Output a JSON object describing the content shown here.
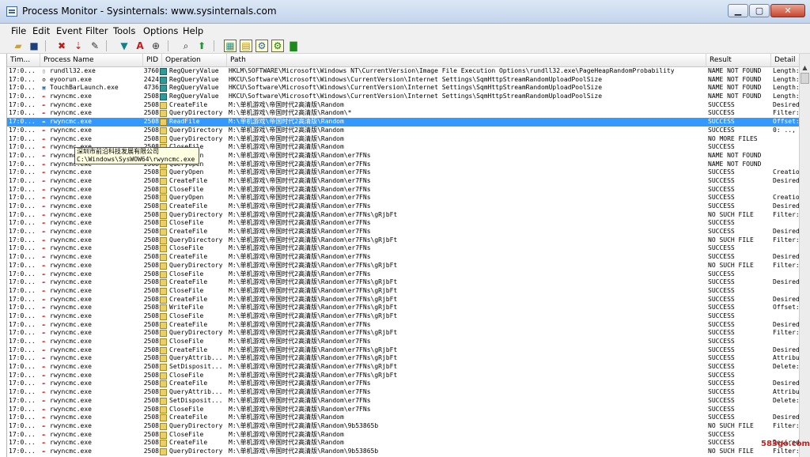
{
  "window": {
    "title": "Process Monitor - Sysinternals: www.sysinternals.com",
    "min": "▁",
    "max": "▢",
    "close": "✕"
  },
  "menu": [
    "File",
    "Edit",
    "Event",
    "Filter",
    "Tools",
    "Options",
    "Help"
  ],
  "columns": [
    "Tim...",
    "Process Name",
    "PID",
    "Operation",
    "Path",
    "Result",
    "Detail"
  ],
  "rows": [
    {
      "t": "17:0...",
      "p": "rundll32.exe",
      "pid": "3760",
      "op": "RegQueryValue",
      "path": "HKLM\\SOFTWARE\\Microsoft\\Windows NT\\CurrentVersion\\Image File Execution Options\\rundll32.exe\\PageHeapRandomProbability",
      "res": "NAME NOT FOUND",
      "det": "Length:",
      "pi": "doc",
      "oi": "reg"
    },
    {
      "t": "17:0...",
      "p": "eyoorun.exe",
      "pid": "2424",
      "op": "RegQueryValue",
      "path": "HKCU\\Software\\Microsoft\\Windows\\CurrentVersion\\Internet Settings\\SqmHttpStreamRandomUploadPoolSize",
      "res": "NAME NOT FOUND",
      "det": "Length:",
      "pi": "gear",
      "oi": "reg"
    },
    {
      "t": "17:0...",
      "p": "TouchBarLaunch.exe",
      "pid": "4736",
      "op": "RegQueryValue",
      "path": "HKCU\\Software\\Microsoft\\Windows\\CurrentVersion\\Internet Settings\\SqmHttpStreamRandomUploadPoolSize",
      "res": "NAME NOT FOUND",
      "det": "Length:",
      "pi": "app",
      "oi": "reg"
    },
    {
      "t": "17:0...",
      "p": "rwyncmc.exe",
      "pid": "2508",
      "op": "RegQueryValue",
      "path": "HKCU\\Software\\Microsoft\\Windows\\CurrentVersion\\Internet Settings\\SqmHttpStreamRandomUploadPoolSize",
      "res": "NAME NOT FOUND",
      "det": "Length:",
      "pi": "feather",
      "oi": "reg"
    },
    {
      "t": "17:0...",
      "p": "rwyncmc.exe",
      "pid": "2508",
      "op": "CreateFile",
      "path": "M:\\单机游戏\\帝国时代2高清版\\Random",
      "res": "SUCCESS",
      "det": "Desired",
      "pi": "feather",
      "oi": "file"
    },
    {
      "t": "17:0...",
      "p": "rwyncmc.exe",
      "pid": "2508",
      "op": "QueryDirectory",
      "path": "M:\\单机游戏\\帝国时代2高清版\\Random\\*",
      "res": "SUCCESS",
      "det": "Filter:",
      "pi": "feather",
      "oi": "file"
    },
    {
      "t": "17:0...",
      "p": "rwyncmc.exe",
      "pid": "2508",
      "op": "ReadFile",
      "path": "M:\\单机游戏\\帝国时代2高清版\\Random",
      "res": "SUCCESS",
      "det": "Offset:",
      "pi": "feather",
      "oi": "file",
      "sel": true
    },
    {
      "t": "17:0...",
      "p": "rwyncmc.exe",
      "pid": "2508",
      "op": "QueryDirectory",
      "path": "M:\\单机游戏\\帝国时代2高清版\\Random",
      "res": "SUCCESS",
      "det": "0: ..,",
      "pi": "feather",
      "oi": "file"
    },
    {
      "t": "17:0...",
      "p": "rwyncmc.exe",
      "pid": "2508",
      "op": "QueryDirectory",
      "path": "M:\\单机游戏\\帝国时代2高清版\\Random",
      "res": "NO MORE FILES",
      "det": "",
      "pi": "feather",
      "oi": "file"
    },
    {
      "t": "17:0...",
      "p": "rwyncmc.exe",
      "pid": "2508",
      "op": "CloseFile",
      "path": "M:\\单机游戏\\帝国时代2高清版\\Random",
      "res": "SUCCESS",
      "det": "",
      "pi": "feather",
      "oi": "file"
    },
    {
      "t": "17:0...",
      "p": "rwyncmc.exe",
      "pid": "2508",
      "op": "QueryOpen",
      "path": "M:\\单机游戏\\帝国时代2高清版\\Random\\er7FNs",
      "res": "NAME NOT FOUND",
      "det": "",
      "pi": "feather",
      "oi": "file"
    },
    {
      "t": "17:0...",
      "p": "rwyncmc.exe",
      "pid": "2508",
      "op": "QueryOpen",
      "path": "M:\\单机游戏\\帝国时代2高清版\\Random\\er7FNs",
      "res": "NAME NOT FOUND",
      "det": "",
      "pi": "feather",
      "oi": "file"
    },
    {
      "t": "17:0...",
      "p": "rwyncmc.exe",
      "pid": "2508",
      "op": "QueryOpen",
      "path": "M:\\单机游戏\\帝国时代2高清版\\Random\\er7FNs",
      "res": "SUCCESS",
      "det": "Creation",
      "pi": "feather",
      "oi": "file"
    },
    {
      "t": "17:0...",
      "p": "rwyncmc.exe",
      "pid": "2508",
      "op": "CreateFile",
      "path": "M:\\单机游戏\\帝国时代2高清版\\Random\\er7FNs",
      "res": "SUCCESS",
      "det": "Desired",
      "pi": "feather",
      "oi": "file"
    },
    {
      "t": "17:0...",
      "p": "rwyncmc.exe",
      "pid": "2508",
      "op": "CloseFile",
      "path": "M:\\单机游戏\\帝国时代2高清版\\Random\\er7FNs",
      "res": "SUCCESS",
      "det": "",
      "pi": "feather",
      "oi": "file"
    },
    {
      "t": "17:0...",
      "p": "rwyncmc.exe",
      "pid": "2508",
      "op": "QueryOpen",
      "path": "M:\\单机游戏\\帝国时代2高清版\\Random\\er7FNs",
      "res": "SUCCESS",
      "det": "Creation",
      "pi": "feather",
      "oi": "file"
    },
    {
      "t": "17:0...",
      "p": "rwyncmc.exe",
      "pid": "2508",
      "op": "CreateFile",
      "path": "M:\\单机游戏\\帝国时代2高清版\\Random\\er7FNs",
      "res": "SUCCESS",
      "det": "Desired",
      "pi": "feather",
      "oi": "file"
    },
    {
      "t": "17:0...",
      "p": "rwyncmc.exe",
      "pid": "2508",
      "op": "QueryDirectory",
      "path": "M:\\单机游戏\\帝国时代2高清版\\Random\\er7FNs\\gRjbFt",
      "res": "NO SUCH FILE",
      "det": "Filter:",
      "pi": "feather",
      "oi": "file"
    },
    {
      "t": "17:0...",
      "p": "rwyncmc.exe",
      "pid": "2508",
      "op": "CloseFile",
      "path": "M:\\单机游戏\\帝国时代2高清版\\Random\\er7FNs",
      "res": "SUCCESS",
      "det": "",
      "pi": "feather",
      "oi": "file"
    },
    {
      "t": "17:0...",
      "p": "rwyncmc.exe",
      "pid": "2508",
      "op": "CreateFile",
      "path": "M:\\单机游戏\\帝国时代2高清版\\Random\\er7FNs",
      "res": "SUCCESS",
      "det": "Desired",
      "pi": "feather",
      "oi": "file"
    },
    {
      "t": "17:0...",
      "p": "rwyncmc.exe",
      "pid": "2508",
      "op": "QueryDirectory",
      "path": "M:\\单机游戏\\帝国时代2高清版\\Random\\er7FNs\\gRjbFt",
      "res": "NO SUCH FILE",
      "det": "Filter:",
      "pi": "feather",
      "oi": "file"
    },
    {
      "t": "17:0...",
      "p": "rwyncmc.exe",
      "pid": "2508",
      "op": "CloseFile",
      "path": "M:\\单机游戏\\帝国时代2高清版\\Random\\er7FNs",
      "res": "SUCCESS",
      "det": "",
      "pi": "feather",
      "oi": "file"
    },
    {
      "t": "17:0...",
      "p": "rwyncmc.exe",
      "pid": "2508",
      "op": "CreateFile",
      "path": "M:\\单机游戏\\帝国时代2高清版\\Random\\er7FNs",
      "res": "SUCCESS",
      "det": "Desired",
      "pi": "feather",
      "oi": "file"
    },
    {
      "t": "17:0...",
      "p": "rwyncmc.exe",
      "pid": "2508",
      "op": "QueryDirectory",
      "path": "M:\\单机游戏\\帝国时代2高清版\\Random\\er7FNs\\gRjbFt",
      "res": "NO SUCH FILE",
      "det": "Filter:",
      "pi": "feather",
      "oi": "file"
    },
    {
      "t": "17:0...",
      "p": "rwyncmc.exe",
      "pid": "2508",
      "op": "CloseFile",
      "path": "M:\\单机游戏\\帝国时代2高清版\\Random\\er7FNs",
      "res": "SUCCESS",
      "det": "",
      "pi": "feather",
      "oi": "file"
    },
    {
      "t": "17:0...",
      "p": "rwyncmc.exe",
      "pid": "2508",
      "op": "CreateFile",
      "path": "M:\\单机游戏\\帝国时代2高清版\\Random\\er7FNs\\gRjbFt",
      "res": "SUCCESS",
      "det": "Desired",
      "pi": "feather",
      "oi": "file"
    },
    {
      "t": "17:0...",
      "p": "rwyncmc.exe",
      "pid": "2508",
      "op": "CloseFile",
      "path": "M:\\单机游戏\\帝国时代2高清版\\Random\\er7FNs\\gRjbFt",
      "res": "SUCCESS",
      "det": "",
      "pi": "feather",
      "oi": "file"
    },
    {
      "t": "17:0...",
      "p": "rwyncmc.exe",
      "pid": "2508",
      "op": "CreateFile",
      "path": "M:\\单机游戏\\帝国时代2高清版\\Random\\er7FNs\\gRjbFt",
      "res": "SUCCESS",
      "det": "Desired",
      "pi": "feather",
      "oi": "file"
    },
    {
      "t": "17:0...",
      "p": "rwyncmc.exe",
      "pid": "2508",
      "op": "WriteFile",
      "path": "M:\\单机游戏\\帝国时代2高清版\\Random\\er7FNs\\gRjbFt",
      "res": "SUCCESS",
      "det": "Offset:",
      "pi": "feather",
      "oi": "file"
    },
    {
      "t": "17:0...",
      "p": "rwyncmc.exe",
      "pid": "2508",
      "op": "CloseFile",
      "path": "M:\\单机游戏\\帝国时代2高清版\\Random\\er7FNs\\gRjbFt",
      "res": "SUCCESS",
      "det": "",
      "pi": "feather",
      "oi": "file"
    },
    {
      "t": "17:0...",
      "p": "rwyncmc.exe",
      "pid": "2508",
      "op": "CreateFile",
      "path": "M:\\单机游戏\\帝国时代2高清版\\Random\\er7FNs",
      "res": "SUCCESS",
      "det": "Desired",
      "pi": "feather",
      "oi": "file"
    },
    {
      "t": "17:0...",
      "p": "rwyncmc.exe",
      "pid": "2508",
      "op": "QueryDirectory",
      "path": "M:\\单机游戏\\帝国时代2高清版\\Random\\er7FNs\\gRjbFt",
      "res": "SUCCESS",
      "det": "Filter:",
      "pi": "feather",
      "oi": "file"
    },
    {
      "t": "17:0...",
      "p": "rwyncmc.exe",
      "pid": "2508",
      "op": "CloseFile",
      "path": "M:\\单机游戏\\帝国时代2高清版\\Random\\er7FNs",
      "res": "SUCCESS",
      "det": "",
      "pi": "feather",
      "oi": "file"
    },
    {
      "t": "17:0...",
      "p": "rwyncmc.exe",
      "pid": "2508",
      "op": "CreateFile",
      "path": "M:\\单机游戏\\帝国时代2高清版\\Random\\er7FNs\\gRjbFt",
      "res": "SUCCESS",
      "det": "Desired",
      "pi": "feather",
      "oi": "file"
    },
    {
      "t": "17:0...",
      "p": "rwyncmc.exe",
      "pid": "2508",
      "op": "QueryAttrib...",
      "path": "M:\\单机游戏\\帝国时代2高清版\\Random\\er7FNs\\gRjbFt",
      "res": "SUCCESS",
      "det": "Attribu",
      "pi": "feather",
      "oi": "file"
    },
    {
      "t": "17:0...",
      "p": "rwyncmc.exe",
      "pid": "2508",
      "op": "SetDisposit...",
      "path": "M:\\单机游戏\\帝国时代2高清版\\Random\\er7FNs\\gRjbFt",
      "res": "SUCCESS",
      "det": "Delete:",
      "pi": "feather",
      "oi": "file"
    },
    {
      "t": "17:0...",
      "p": "rwyncmc.exe",
      "pid": "2508",
      "op": "CloseFile",
      "path": "M:\\单机游戏\\帝国时代2高清版\\Random\\er7FNs\\gRjbFt",
      "res": "SUCCESS",
      "det": "",
      "pi": "feather",
      "oi": "file"
    },
    {
      "t": "17:0...",
      "p": "rwyncmc.exe",
      "pid": "2508",
      "op": "CreateFile",
      "path": "M:\\单机游戏\\帝国时代2高清版\\Random\\er7FNs",
      "res": "SUCCESS",
      "det": "Desired",
      "pi": "feather",
      "oi": "file"
    },
    {
      "t": "17:0...",
      "p": "rwyncmc.exe",
      "pid": "2508",
      "op": "QueryAttrib...",
      "path": "M:\\单机游戏\\帝国时代2高清版\\Random\\er7FNs",
      "res": "SUCCESS",
      "det": "Attribu",
      "pi": "feather",
      "oi": "file"
    },
    {
      "t": "17:0...",
      "p": "rwyncmc.exe",
      "pid": "2508",
      "op": "SetDisposit...",
      "path": "M:\\单机游戏\\帝国时代2高清版\\Random\\er7FNs",
      "res": "SUCCESS",
      "det": "Delete:",
      "pi": "feather",
      "oi": "file"
    },
    {
      "t": "17:0...",
      "p": "rwyncmc.exe",
      "pid": "2508",
      "op": "CloseFile",
      "path": "M:\\单机游戏\\帝国时代2高清版\\Random\\er7FNs",
      "res": "SUCCESS",
      "det": "",
      "pi": "feather",
      "oi": "file"
    },
    {
      "t": "17:0...",
      "p": "rwyncmc.exe",
      "pid": "2508",
      "op": "CreateFile",
      "path": "M:\\单机游戏\\帝国时代2高清版\\Random",
      "res": "SUCCESS",
      "det": "Desired",
      "pi": "feather",
      "oi": "file"
    },
    {
      "t": "17:0...",
      "p": "rwyncmc.exe",
      "pid": "2508",
      "op": "QueryDirectory",
      "path": "M:\\单机游戏\\帝国时代2高清版\\Random\\9b53865b",
      "res": "NO SUCH FILE",
      "det": "Filter:",
      "pi": "feather",
      "oi": "file"
    },
    {
      "t": "17:0...",
      "p": "rwyncmc.exe",
      "pid": "2508",
      "op": "CloseFile",
      "path": "M:\\单机游戏\\帝国时代2高清版\\Random",
      "res": "SUCCESS",
      "det": "",
      "pi": "feather",
      "oi": "file"
    },
    {
      "t": "17:0...",
      "p": "rwyncmc.exe",
      "pid": "2508",
      "op": "CreateFile",
      "path": "M:\\单机游戏\\帝国时代2高清版\\Random",
      "res": "SUCCESS",
      "det": "Desired",
      "pi": "feather",
      "oi": "file"
    },
    {
      "t": "17:0...",
      "p": "rwyncmc.exe",
      "pid": "2508",
      "op": "QueryDirectory",
      "path": "M:\\单机游戏\\帝国时代2高清版\\Random\\9b53865b",
      "res": "NO SUCH FILE",
      "det": "Filter:",
      "pi": "feather",
      "oi": "file"
    }
  ],
  "tooltip": {
    "line1": "深圳市前沿科技发展有限公司",
    "line2": "C:\\Windows\\SysWOW64\\rwyncmc.exe"
  },
  "watermark": "583go.com"
}
